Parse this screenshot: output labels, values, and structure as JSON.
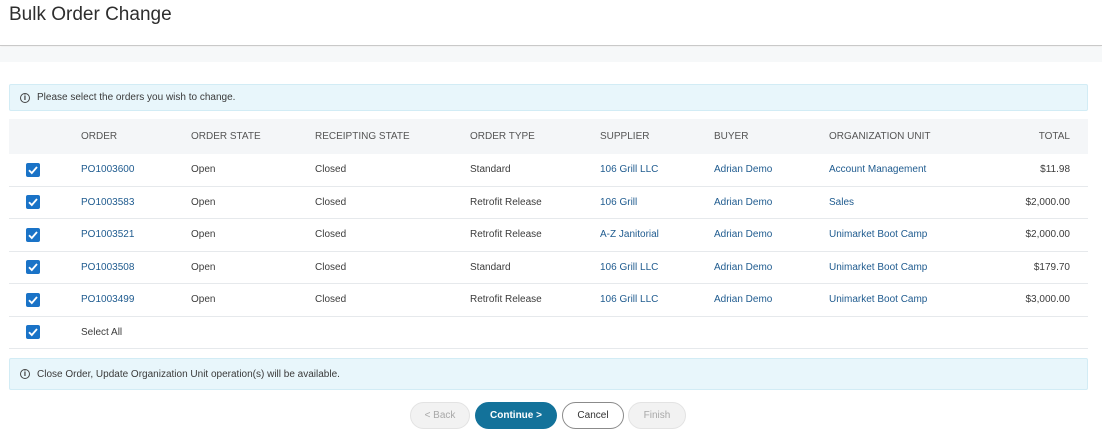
{
  "page": {
    "title": "Bulk Order Change"
  },
  "info_top": "Please select the orders you wish to change.",
  "table": {
    "headers": {
      "order": "ORDER",
      "order_state": "ORDER STATE",
      "receipting_state": "RECEIPTING STATE",
      "order_type": "ORDER TYPE",
      "supplier": "SUPPLIER",
      "buyer": "BUYER",
      "org_unit": "ORGANIZATION UNIT",
      "total": "TOTAL"
    },
    "rows": [
      {
        "checked": true,
        "order": "PO1003600",
        "order_state": "Open",
        "receipting_state": "Closed",
        "order_type": "Standard",
        "supplier": "106 Grill LLC",
        "buyer": "Adrian Demo",
        "org_unit": "Account Management",
        "total": "$11.98"
      },
      {
        "checked": true,
        "order": "PO1003583",
        "order_state": "Open",
        "receipting_state": "Closed",
        "order_type": "Retrofit Release",
        "supplier": "106 Grill",
        "buyer": "Adrian Demo",
        "org_unit": "Sales",
        "total": "$2,000.00"
      },
      {
        "checked": true,
        "order": "PO1003521",
        "order_state": "Open",
        "receipting_state": "Closed",
        "order_type": "Retrofit Release",
        "supplier": "A-Z Janitorial",
        "buyer": "Adrian Demo",
        "org_unit": "Unimarket Boot Camp",
        "total": "$2,000.00"
      },
      {
        "checked": true,
        "order": "PO1003508",
        "order_state": "Open",
        "receipting_state": "Closed",
        "order_type": "Standard",
        "supplier": "106 Grill LLC",
        "buyer": "Adrian Demo",
        "org_unit": "Unimarket Boot Camp",
        "total": "$179.70"
      },
      {
        "checked": true,
        "order": "PO1003499",
        "order_state": "Open",
        "receipting_state": "Closed",
        "order_type": "Retrofit Release",
        "supplier": "106 Grill LLC",
        "buyer": "Adrian Demo",
        "org_unit": "Unimarket Boot Camp",
        "total": "$3,000.00"
      }
    ],
    "select_all_label": "Select All",
    "select_all_checked": true
  },
  "info_bottom": "Close Order, Update Organization Unit operation(s) will be available.",
  "buttons": {
    "back": "< Back",
    "continue": "Continue >",
    "cancel": "Cancel",
    "finish": "Finish"
  },
  "colors": {
    "accent": "#13729a",
    "checkbox": "#1a73c7",
    "link": "#1f5b8f",
    "info_bg": "#e8f6fb"
  },
  "icons": {
    "info": "info-circle-icon",
    "check": "checkmark-icon"
  }
}
